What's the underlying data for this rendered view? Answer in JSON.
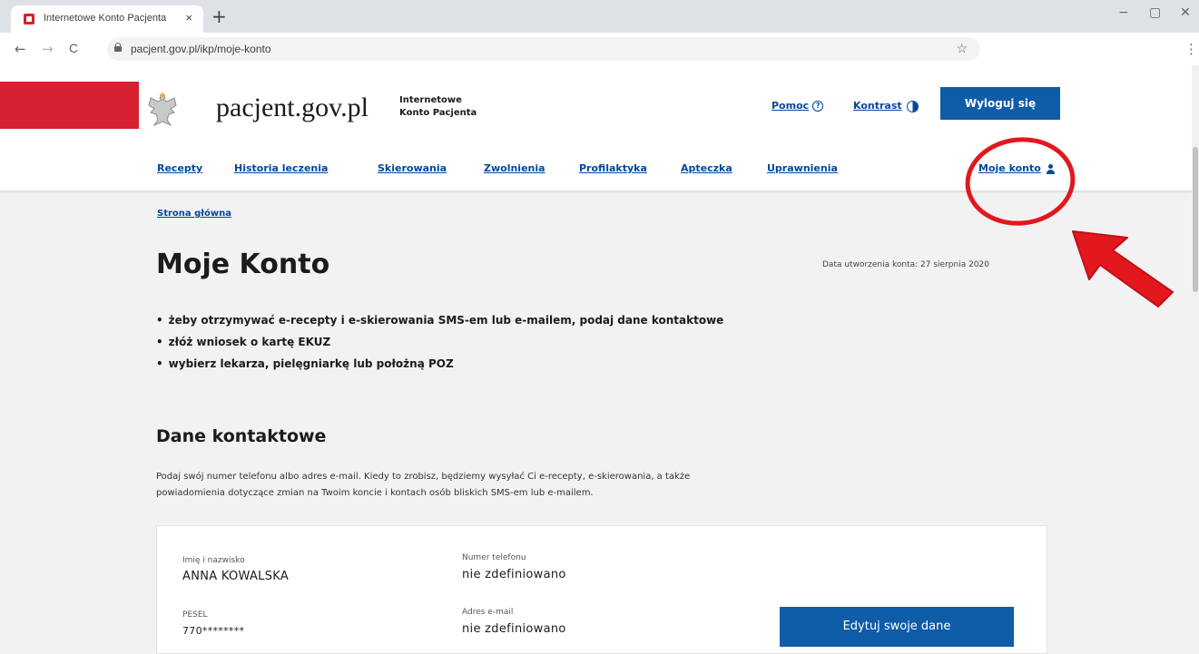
{
  "browser": {
    "tab_title": "Internetowe Konto Pacjenta",
    "tab_close": "×",
    "new_tab": "+",
    "url": "pacjent.gov.pl/ikp/moje-konto",
    "back": "←",
    "forward": "→",
    "reload": "C",
    "star": "☆",
    "menu": "⋮",
    "minimize": "−",
    "maximize": "▢",
    "close": "✕"
  },
  "header": {
    "site_name": "pacjent.gov.pl",
    "subtitle_line1": "Internetowe",
    "subtitle_line2": "Konto Pacjenta",
    "help_label": "Pomoc",
    "help_icon_glyph": "?",
    "contrast_label": "Kontrast",
    "logout_label": "Wyloguj się",
    "brand_red": "#d5202f",
    "accent_blue": "#0f5ca8",
    "link_blue": "#00489e"
  },
  "nav": {
    "items": [
      "Recepty",
      "Historia leczenia",
      "Skierowania",
      "Zwolnienia",
      "Profilaktyka",
      "Apteczka",
      "Uprawnienia"
    ],
    "account_label": "Moje konto"
  },
  "page": {
    "breadcrumb": "Strona główna",
    "title": "Moje Konto",
    "created": "Data utworzenia konta: 27 sierpnia 2020",
    "bullets": [
      "żeby otrzymywać e-recepty i e-skierowania SMS-em lub e-mailem, podaj dane kontaktowe",
      "złóż wniosek o kartę EKUZ",
      "wybierz lekarza, pielęgniarkę lub położną POZ"
    ]
  },
  "contact": {
    "section_title": "Dane kontaktowe",
    "description_line1": "Podaj swój numer telefonu albo adres e-mail. Kiedy to zrobisz, będziemy wysyłać Ci e-recepty, e-skierowania, a także",
    "description_line2": "powiadomienia dotyczące zmian na Twoim koncie i kontach osób bliskich SMS-em lub e-mailem.",
    "name_label": "Imię i nazwisko",
    "name_value": "ANNA KOWALSKA",
    "pesel_label": "PESEL",
    "pesel_value": "770********",
    "phone_label": "Numer telefonu",
    "phone_value": "nie zdefiniowano",
    "email_label": "Adres e-mail",
    "email_value": "nie zdefiniowano",
    "edit_button": "Edytuj swoje dane"
  },
  "annotation": {
    "color": "#e3171e"
  }
}
